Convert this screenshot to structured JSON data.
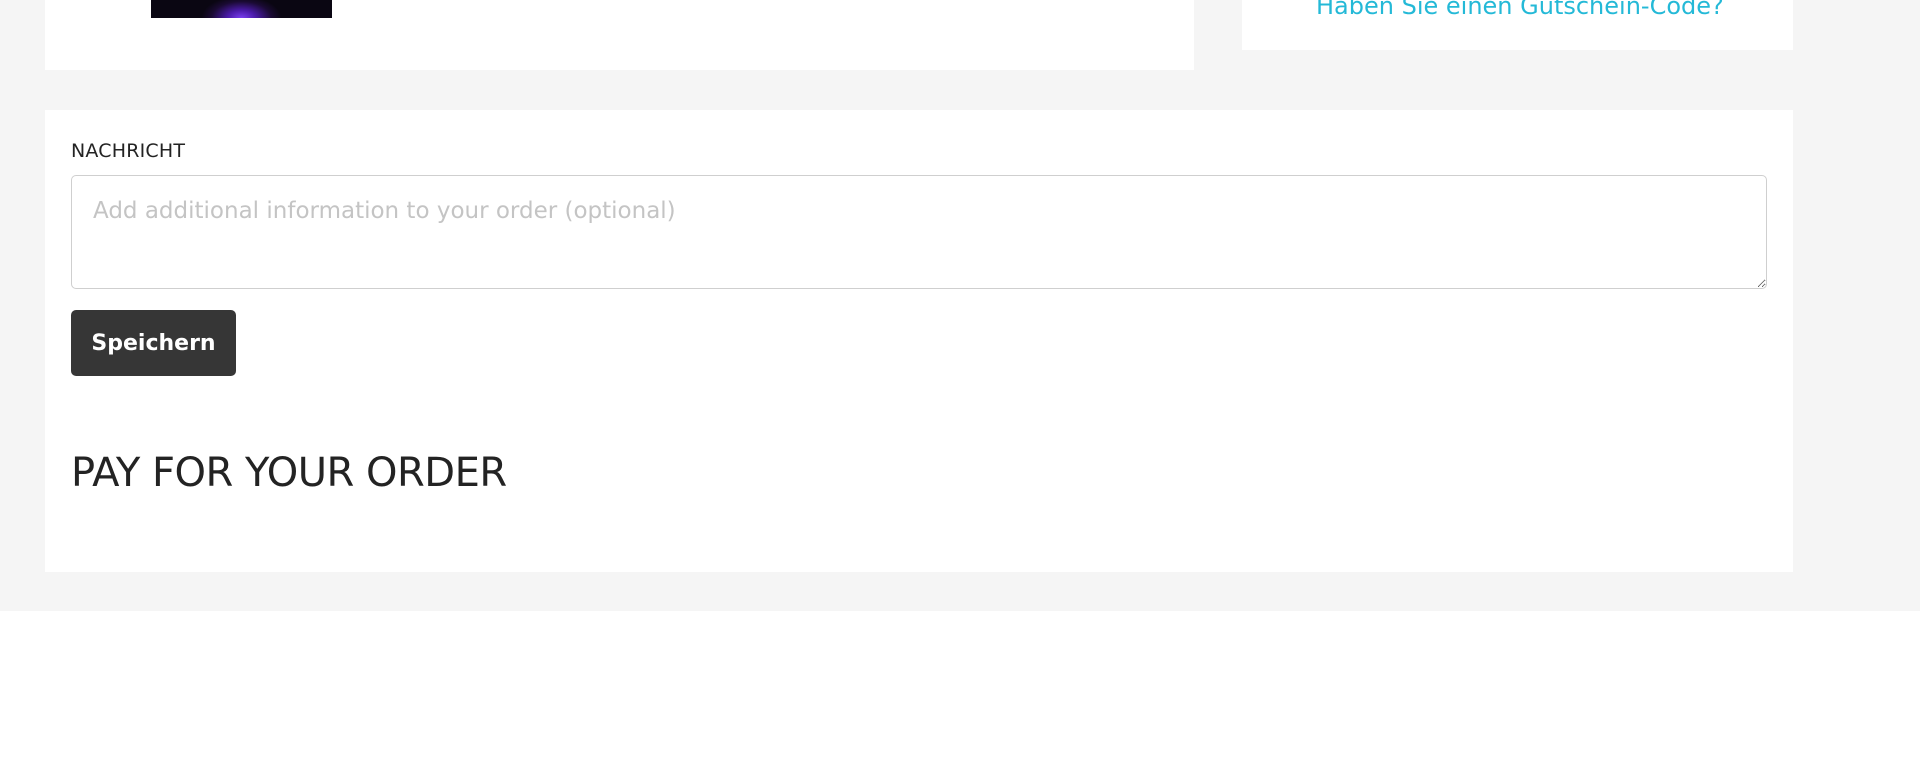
{
  "voucher": {
    "link_text": "Haben Sie einen Gutschein-Code?"
  },
  "message": {
    "label": "NACHRICHT",
    "placeholder": "Add additional information to your order (optional)",
    "value": "",
    "save_label": "Speichern"
  },
  "payment": {
    "heading": "PAY FOR YOUR ORDER"
  },
  "colors": {
    "background": "#f5f5f5",
    "card": "#ffffff",
    "link": "#24b9d7",
    "button": "#363636",
    "text": "#232323"
  }
}
